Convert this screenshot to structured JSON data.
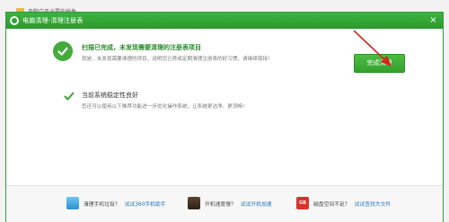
{
  "background_window": {
    "row_text": "电脑中不必要的插件"
  },
  "titlebar": {
    "title": "电脑清理-清理注册表",
    "close_label": "×"
  },
  "result_main": {
    "title": "扫描已完成，未发现需要清理的注册表项目",
    "description": "就是，未发现需要清理的项目，说明您已养成定期清理注册表的好习惯，请继续保持！"
  },
  "finish_button": {
    "label": "完成清理"
  },
  "result_secondary": {
    "title": "当前系统稳定性良好",
    "description": "您还可以使用以下推荐功能进一步优化操作系统，让系统更洁净、更流畅！"
  },
  "promos": [
    {
      "text": "清理手机垃圾？",
      "link": "试试360手机助手",
      "icon": "phone-icon"
    },
    {
      "text": "开机速度慢？",
      "link": "试试开机加速",
      "icon": "speed-icon"
    },
    {
      "text": "磁盘空间不足？",
      "link": "试试查找大文件",
      "icon": "disk-icon",
      "icon_text": "GB"
    }
  ],
  "colors": {
    "accent_green": "#2fa236",
    "link_blue": "#1e6fc9",
    "annotation_red": "#d9251d"
  }
}
